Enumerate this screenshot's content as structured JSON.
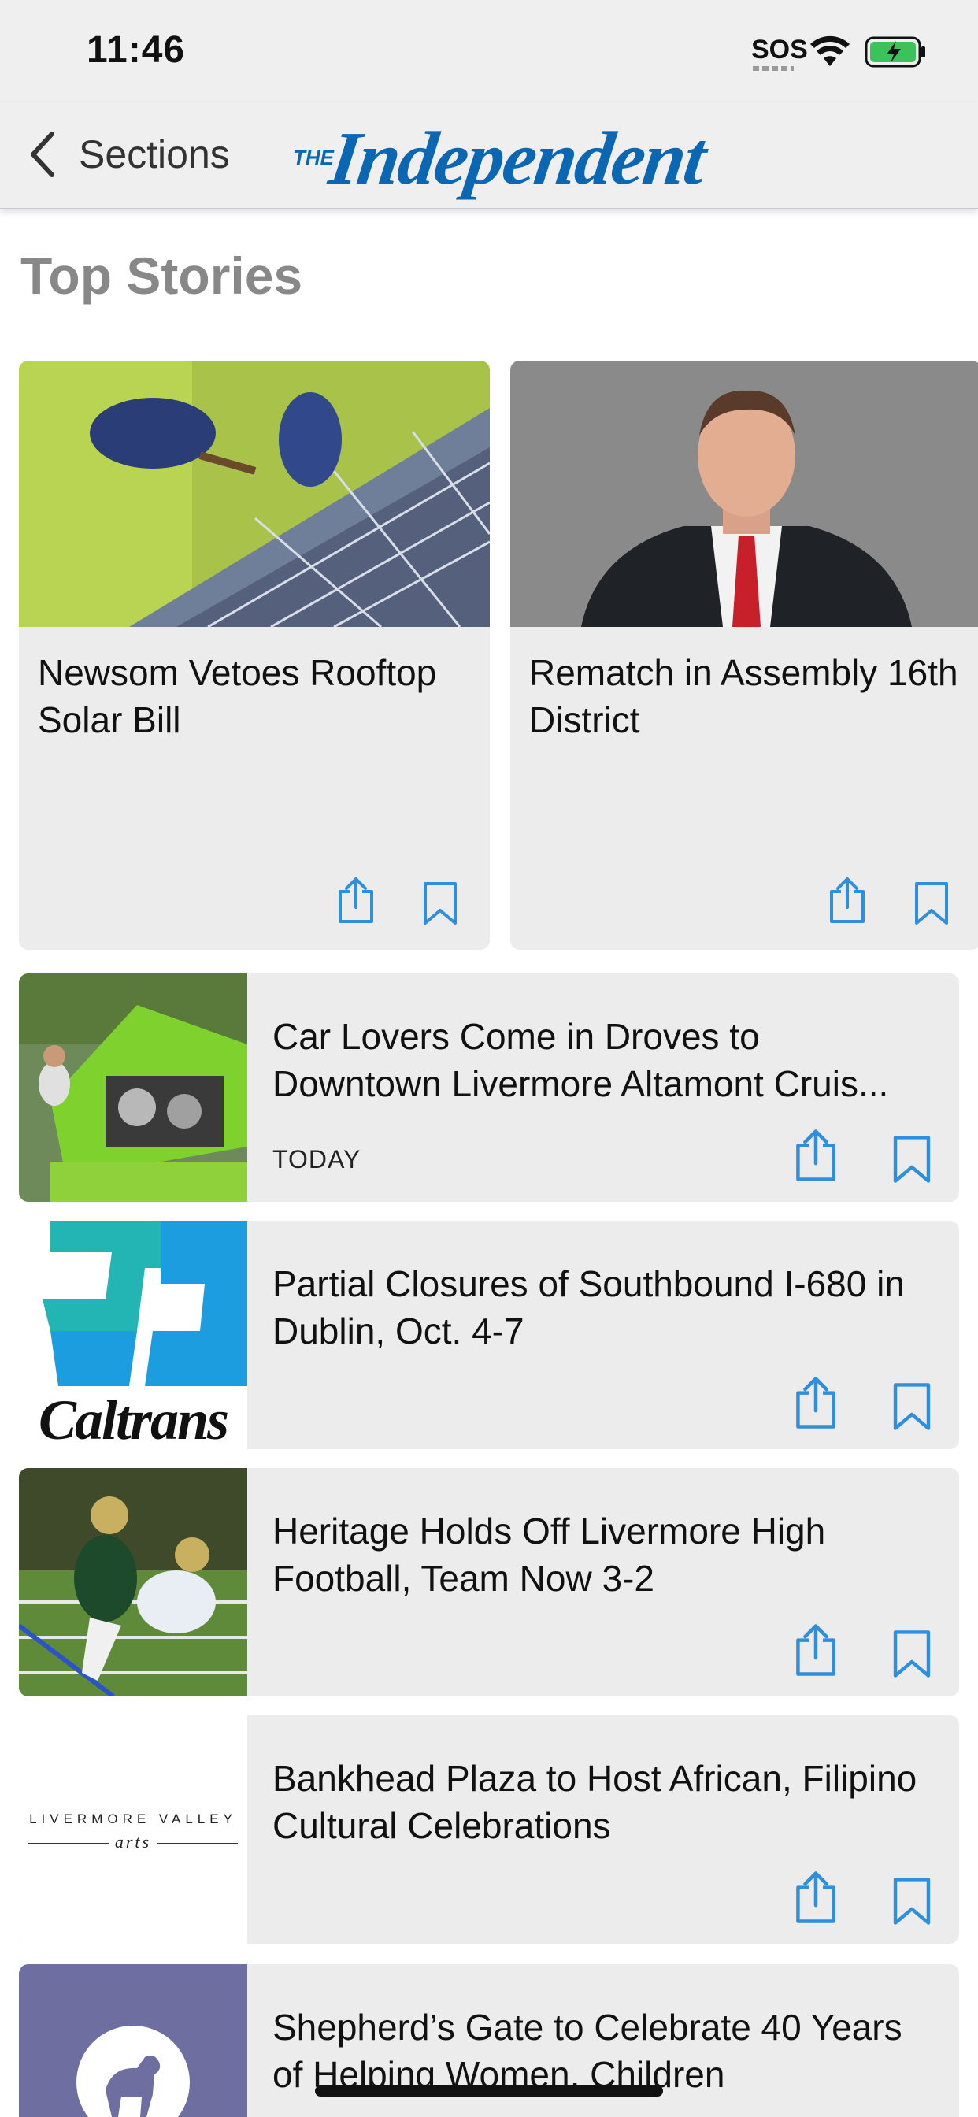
{
  "status_bar": {
    "time": "11:46",
    "sos": "SOS"
  },
  "nav": {
    "back_label": "Sections",
    "logo_the": "THE",
    "logo_main": "Independent"
  },
  "section_title": "Top Stories",
  "top_stories": [
    {
      "title": "Newsom Vetoes Rooftop Solar Bill",
      "image": "solar-panel-photo"
    },
    {
      "title": "Rematch in Assembly 16th District",
      "image": "candidate-portrait-photo"
    }
  ],
  "stories": [
    {
      "title": "Car Lovers Come in Droves to Downtown Livermore Altamont Cruis...",
      "date": "TODAY",
      "image": "classic-car-photo"
    },
    {
      "title": "Partial Closures of Southbound I-680 in Dublin, Oct. 4-7",
      "date": "",
      "image": "caltrans-logo",
      "logo_text": "Caltrans"
    },
    {
      "title": "Heritage Holds Off Livermore High Football, Team Now 3-2",
      "date": "",
      "image": "football-photo"
    },
    {
      "title": "Bankhead Plaza to Host African, Filipino Cultural Celebrations",
      "date": "",
      "image": "livermore-valley-arts-logo",
      "logo_text_top": "LIVERMORE VALLEY",
      "logo_text_bottom": "arts"
    },
    {
      "title": "Shepherd’s Gate to Celebrate 40 Years of Helping Women, Children",
      "date": "",
      "image": "lamb-logo"
    }
  ],
  "colors": {
    "accent": "#2f8fdc",
    "brand": "#0b67b1",
    "background": "#ffffff",
    "card": "#ececec",
    "bar": "#efeff0"
  },
  "icons": {
    "share": "share-icon",
    "bookmark": "bookmark-icon",
    "back": "chevron-left-icon"
  }
}
